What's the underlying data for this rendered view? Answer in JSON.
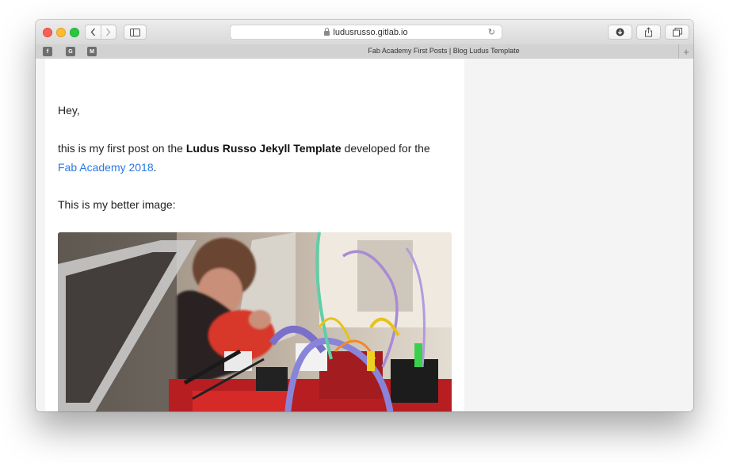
{
  "browser": {
    "url": "ludusrusso.gitlab.io",
    "tab_title": "Fab Academy First Posts | Blog Ludus Template",
    "favorites": [
      "f",
      "G",
      "M"
    ]
  },
  "post": {
    "greeting": "Hey,",
    "intro_pre": "this is my first post on the ",
    "intro_bold": "Ludus Russo Jekyll Template",
    "intro_mid": " developed for the",
    "intro_link": "Fab Academy 2018",
    "intro_end": ".",
    "image_caption": "This is my better image:"
  },
  "colors": {
    "link": "#2a7ae2",
    "sidebar_bg": "#f4f4f4"
  }
}
